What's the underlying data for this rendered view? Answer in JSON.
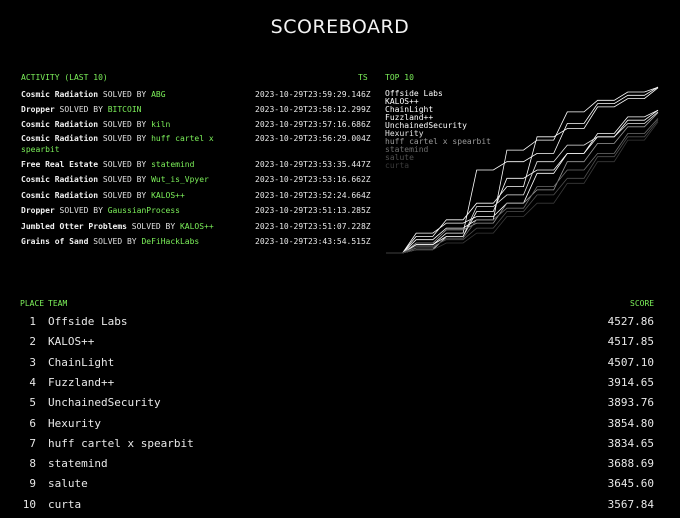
{
  "title": "SCOREBOARD",
  "activity": {
    "header": "ACTIVITY (LAST 10)",
    "ts_header": "TS",
    "solved_by": "SOLVED BY",
    "items": [
      {
        "challenge": "Cosmic Radiation",
        "team": "ABG",
        "ts": "2023-10-29T23:59:29.146Z"
      },
      {
        "challenge": "Dropper",
        "team": "BITCOIN",
        "ts": "2023-10-29T23:58:12.299Z"
      },
      {
        "challenge": "Cosmic Radiation",
        "team": "kiln",
        "ts": "2023-10-29T23:57:16.686Z"
      },
      {
        "challenge": "Cosmic Radiation",
        "team": "huff cartel x spearbit",
        "ts": "2023-10-29T23:56:29.004Z"
      },
      {
        "challenge": "Free Real Estate",
        "team": "statemind",
        "ts": "2023-10-29T23:53:35.447Z"
      },
      {
        "challenge": "Cosmic Radiation",
        "team": "Wut_is_Vpyer",
        "ts": "2023-10-29T23:53:16.662Z"
      },
      {
        "challenge": "Cosmic Radiation",
        "team": "KALOS++",
        "ts": "2023-10-29T23:52:24.664Z"
      },
      {
        "challenge": "Dropper",
        "team": "GaussianProcess",
        "ts": "2023-10-29T23:51:13.285Z"
      },
      {
        "challenge": "Jumbled Otter Problems",
        "team": "KALOS++",
        "ts": "2023-10-29T23:51:07.228Z"
      },
      {
        "challenge": "Grains of Sand",
        "team": "DeFiHackLabs",
        "ts": "2023-10-29T23:43:54.515Z"
      }
    ]
  },
  "top10": {
    "header": "TOP 10",
    "teams": [
      "Offside Labs",
      "KALOS++",
      "ChainLight",
      "Fuzzland++",
      "UnchainedSecurity",
      "Hexurity",
      "huff cartel x spearbit",
      "statemind",
      "salute",
      "curta"
    ],
    "colors": [
      "#ffffff",
      "#ffffff",
      "#ffffff",
      "#ffffff",
      "#ffffff",
      "#e6e6e6",
      "#9a9a9a",
      "#6e6e6e",
      "#505050",
      "#3a3a3a"
    ]
  },
  "chart_data": {
    "type": "line",
    "legend": "top-left",
    "series": [
      {
        "name": "Offside Labs",
        "values": [
          0,
          0.05,
          0.12,
          0.5,
          0.55,
          0.6,
          0.78,
          0.9,
          0.95,
          1.0
        ]
      },
      {
        "name": "KALOS++",
        "values": [
          0,
          0.08,
          0.15,
          0.2,
          0.62,
          0.68,
          0.85,
          0.92,
          0.97,
          0.998
        ]
      },
      {
        "name": "ChainLight",
        "values": [
          0,
          0.1,
          0.2,
          0.3,
          0.4,
          0.7,
          0.75,
          0.88,
          0.93,
          0.995
        ]
      },
      {
        "name": "Fuzzland++",
        "values": [
          0,
          0.05,
          0.1,
          0.25,
          0.45,
          0.5,
          0.6,
          0.7,
          0.8,
          0.86
        ]
      },
      {
        "name": "UnchainedSecurity",
        "values": [
          0,
          0.12,
          0.18,
          0.22,
          0.3,
          0.48,
          0.6,
          0.72,
          0.82,
          0.86
        ]
      },
      {
        "name": "Hexurity",
        "values": [
          0,
          0.02,
          0.1,
          0.28,
          0.35,
          0.55,
          0.65,
          0.7,
          0.78,
          0.85
        ]
      },
      {
        "name": "huff cartel x spearbit",
        "values": [
          0,
          0.06,
          0.14,
          0.18,
          0.3,
          0.38,
          0.55,
          0.66,
          0.76,
          0.845
        ]
      },
      {
        "name": "statemind",
        "values": [
          0,
          0.03,
          0.09,
          0.2,
          0.27,
          0.4,
          0.5,
          0.6,
          0.72,
          0.81
        ]
      },
      {
        "name": "salute",
        "values": [
          0,
          0.04,
          0.08,
          0.15,
          0.25,
          0.35,
          0.45,
          0.58,
          0.7,
          0.8
        ]
      },
      {
        "name": "curta",
        "values": [
          0,
          0.02,
          0.06,
          0.12,
          0.22,
          0.3,
          0.42,
          0.55,
          0.68,
          0.79
        ]
      }
    ]
  },
  "leaderboard": {
    "place_header": "PLACE",
    "team_header": "TEAM",
    "score_header": "SCORE",
    "rows": [
      {
        "place": "1",
        "team": "Offside Labs",
        "score": "4527.86"
      },
      {
        "place": "2",
        "team": "KALOS++",
        "score": "4517.85"
      },
      {
        "place": "3",
        "team": "ChainLight",
        "score": "4507.10"
      },
      {
        "place": "4",
        "team": "Fuzzland++",
        "score": "3914.65"
      },
      {
        "place": "5",
        "team": "UnchainedSecurity",
        "score": "3893.76"
      },
      {
        "place": "6",
        "team": "Hexurity",
        "score": "3854.80"
      },
      {
        "place": "7",
        "team": "huff cartel x spearbit",
        "score": "3834.65"
      },
      {
        "place": "8",
        "team": "statemind",
        "score": "3688.69"
      },
      {
        "place": "9",
        "team": "salute",
        "score": "3645.60"
      },
      {
        "place": "10",
        "team": "curta",
        "score": "3567.84"
      }
    ]
  }
}
